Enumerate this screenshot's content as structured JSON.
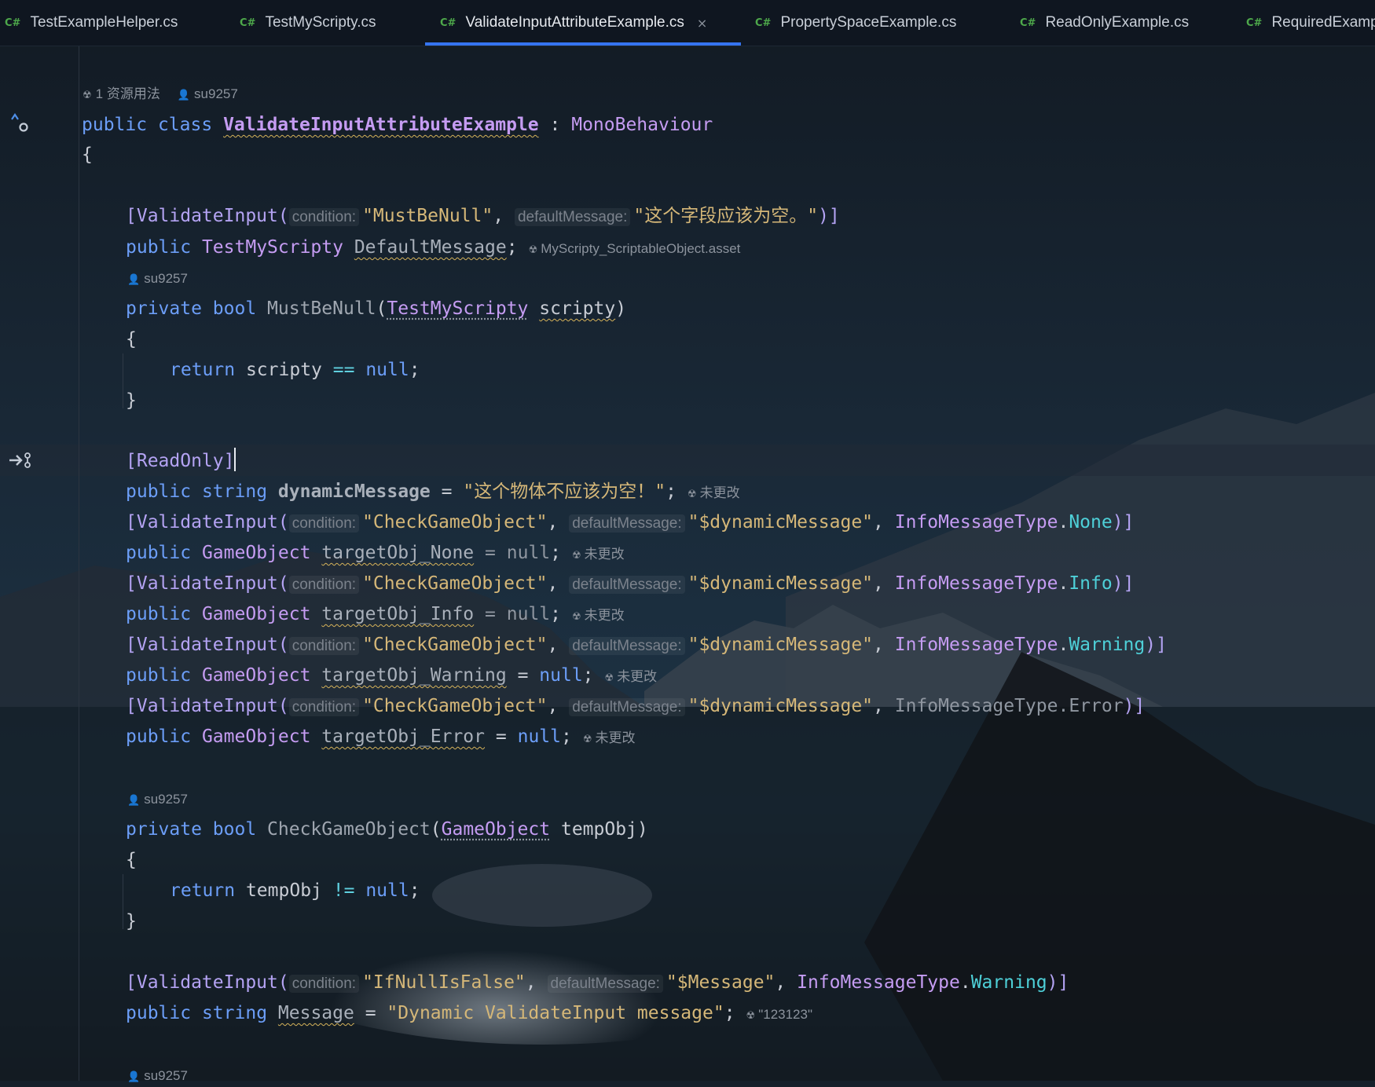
{
  "tabs": [
    {
      "icon": "C#",
      "label": "TestExampleHelper.cs"
    },
    {
      "icon": "C#",
      "label": "TestMyScripty.cs"
    },
    {
      "icon": "C#",
      "label": "ValidateInputAttributeExample.cs",
      "close": "×"
    },
    {
      "icon": "C#",
      "label": "PropertySpaceExample.cs"
    },
    {
      "icon": "C#",
      "label": "ReadOnlyExample.cs"
    },
    {
      "icon": "C#",
      "label": "RequiredExamp"
    }
  ],
  "hints": {
    "class_usage": "1 资源用法",
    "author": "su9257",
    "asset": "MyScripty_ScriptableObject.asset",
    "unchanged": "未更改",
    "message_value": "\"123123\""
  },
  "params": {
    "condition": "condition:",
    "default_message": "defaultMessage:"
  },
  "code": {
    "l1": {
      "k1": "public",
      "k2": "class",
      "name": "ValidateInputAttributeExample",
      "colon": ":",
      "base": "MonoBehaviour"
    },
    "brace_open": "{",
    "brace_close": "}",
    "a1": {
      "open": "[ValidateInput(",
      "cond": "\"MustBeNull\"",
      "comma": ",",
      "msg": "\"这个字段应该为空。\"",
      "close": ")]"
    },
    "d1": {
      "k": "public",
      "type": "TestMyScripty",
      "name": "DefaultMessage",
      "semi": ";"
    },
    "m1": {
      "k1": "private",
      "k2": "bool",
      "name": "MustBeNull",
      "paren": "(",
      "ptype": "TestMyScripty",
      "pname": "scripty",
      "cparen": ")"
    },
    "r1": {
      "k": "return",
      "v": "scripty",
      "op": "==",
      "nul": "null",
      "semi": ";"
    },
    "readonly": "[ReadOnly]",
    "d2": {
      "k1": "public",
      "k2": "string",
      "name": "dynamicMessage",
      "eq": "=",
      "val": "\"这个物体不应该为空！\"",
      "semi": ";"
    },
    "v_open": "[ValidateInput(",
    "v_cond": "\"CheckGameObject\"",
    "v_comma": ",",
    "v_msg": "\"$dynamicMessage\"",
    "v_enum": "InfoMessageType",
    "v_dot": ".",
    "v_close": ")]",
    "g_public": "public",
    "g_type": "GameObject",
    "g_eq": "=",
    "g_null": "null",
    "g_semi": ";",
    "e_none": "None",
    "e_info": "Info",
    "e_warning": "Warning",
    "e_error": "Error",
    "n_none": "targetObj_None",
    "n_info": "targetObj_Info",
    "n_warning": "targetObj_Warning",
    "n_error": "targetObj_Error",
    "m2": {
      "k1": "private",
      "k2": "bool",
      "name": "CheckGameObject",
      "paren": "(",
      "ptype": "GameObject",
      "pname": "tempObj",
      "cparen": ")"
    },
    "r2": {
      "k": "return",
      "v": "tempObj",
      "op": "!=",
      "nul": "null",
      "semi": ";"
    },
    "a_last": {
      "open": "[ValidateInput(",
      "cond": "\"IfNullIsFalse\"",
      "comma": ",",
      "msg": "\"$Message\"",
      "comma2": ",",
      "enum": "InfoMessageType",
      "dot": ".",
      "val": "Warning",
      "close": ")]"
    },
    "d_last": {
      "k1": "public",
      "k2": "string",
      "name": "Message",
      "eq": "=",
      "val": "\"Dynamic ValidateInput message\"",
      "semi": ";"
    }
  },
  "colors": {
    "keyword": "#6c9ef8",
    "type": "#c59cf2",
    "string": "#d5b778",
    "enum": "#4ed0d8",
    "tab_accent": "#3574f0"
  }
}
